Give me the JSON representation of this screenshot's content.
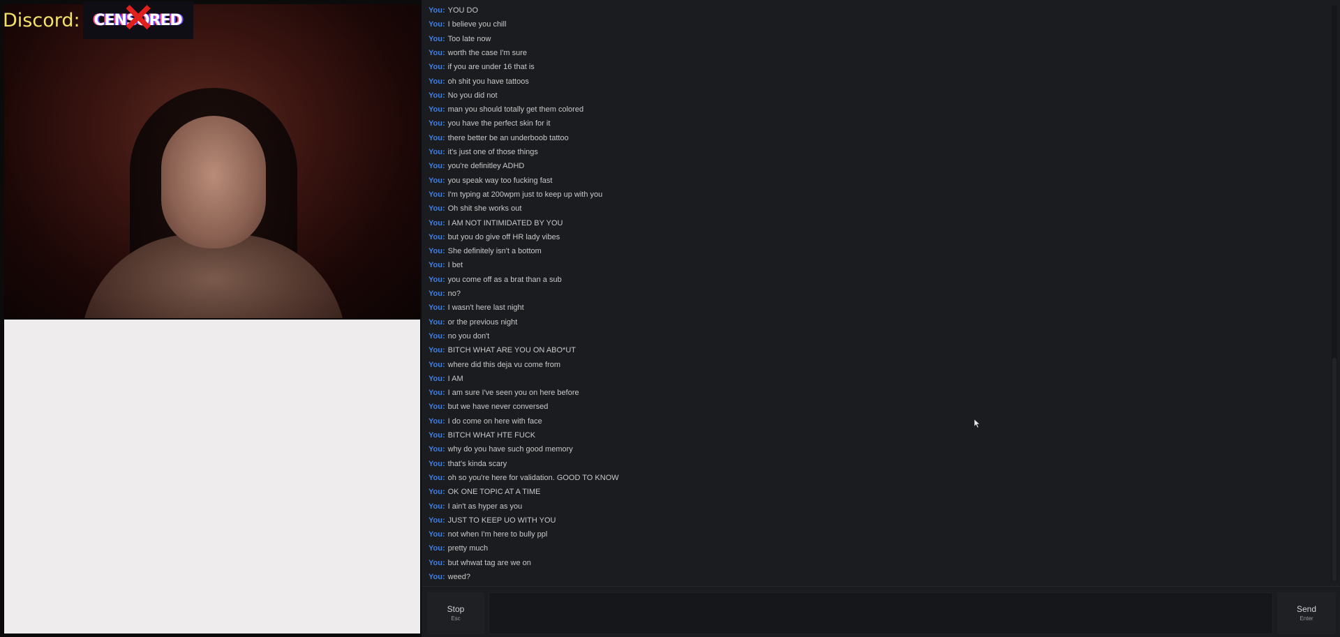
{
  "watermark": {
    "prefix": "Discord:",
    "badge": "CENSORED"
  },
  "chat": {
    "sender": "You:",
    "messages": [
      "YOU DO",
      "I believe you chill",
      "Too late now",
      "worth the case I'm sure",
      "if you are under 16 that is",
      "oh shit you have tattoos",
      "No you did not",
      "man you should totally get them colored",
      "you have the perfect skin for it",
      "there better be an underboob tattoo",
      "it's just one of those things",
      "you're definitley ADHD",
      "you speak way too fucking fast",
      "I'm typing at 200wpm just to keep up with you",
      "Oh shit she works out",
      "I AM NOT INTIMIDATED BY YOU",
      "but you do give off HR lady vibes",
      "She definitely isn't a bottom",
      "I bet",
      "you come off as a brat than a sub",
      "no?",
      "I wasn't here last night",
      "or the previous night",
      "no you don't",
      "BITCH WHAT ARE YOU ON ABO*UT",
      "where did this deja vu come from",
      "I AM",
      "I am sure I've seen you on here before",
      "but we have never conversed",
      "I do come on here with face",
      "BITCH WHAT HTE FUCK",
      "why do you have such good memory",
      "that's kinda scary",
      "oh so you're here for validation. GOOD TO KNOW",
      "OK ONE TOPIC AT A TIME",
      "I ain't as hyper as you",
      "JUST TO KEEP UO WITH YOU",
      "not when I'm here to bully ppl",
      "pretty much",
      "but whwat tag are we on",
      "weed?"
    ]
  },
  "controls": {
    "stop_label": "Stop",
    "stop_hint": "Esc",
    "send_label": "Send",
    "send_hint": "Enter",
    "input_value": ""
  }
}
